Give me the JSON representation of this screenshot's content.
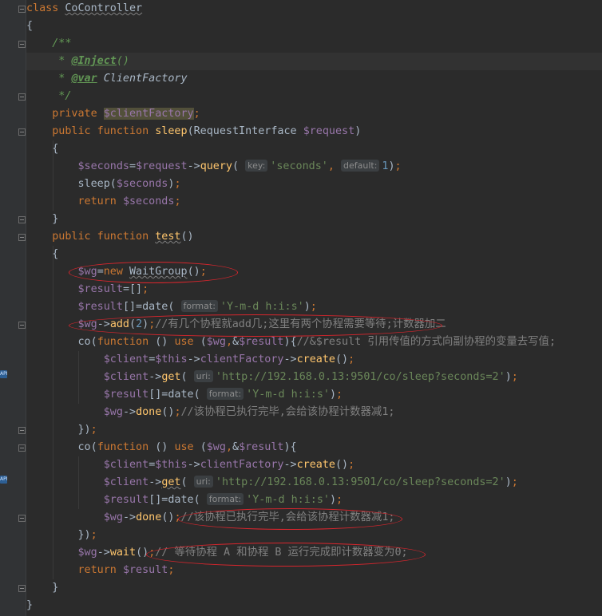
{
  "editor": {
    "lines": [
      {
        "t": [
          {
            "c": "kw",
            "v": "class"
          },
          {
            "v": " "
          },
          {
            "c": "wavy",
            "v": "CoController"
          }
        ]
      },
      {
        "t": [
          {
            "v": "{"
          }
        ]
      },
      {
        "t": [
          {
            "c": "doc",
            "v": "    /**"
          }
        ]
      },
      {
        "hl": true,
        "t": [
          {
            "c": "doc",
            "v": "     * "
          },
          {
            "c": "doctag",
            "v": "@Inject"
          },
          {
            "c": "doc",
            "v": "()"
          }
        ]
      },
      {
        "t": [
          {
            "c": "doc",
            "v": "     * "
          },
          {
            "c": "doctag",
            "v": "@var"
          },
          {
            "c": "docref",
            "v": " ClientFactory"
          }
        ]
      },
      {
        "t": [
          {
            "c": "doc",
            "v": "     */"
          }
        ]
      },
      {
        "t": [
          {
            "c": "kw",
            "v": "    private "
          },
          {
            "c": "var fieldhl",
            "v": "$clientFactory"
          },
          {
            "c": "kw",
            "v": ";"
          }
        ]
      },
      {
        "t": [
          {
            "c": "kw",
            "v": "    public function "
          },
          {
            "c": "fn",
            "v": "sleep"
          },
          {
            "v": "(RequestInterface "
          },
          {
            "c": "var",
            "v": "$request"
          },
          {
            "v": ")"
          }
        ]
      },
      {
        "t": [
          {
            "v": "    {"
          }
        ]
      },
      {
        "t": [
          {
            "c": "var",
            "v": "        $seconds"
          },
          {
            "v": "="
          },
          {
            "c": "var",
            "v": "$request"
          },
          {
            "v": "->"
          },
          {
            "c": "fn",
            "v": "query"
          },
          {
            "v": "( "
          },
          {
            "h": "key:"
          },
          {
            "c": "str",
            "v": "'seconds'"
          },
          {
            "c": "kw",
            "v": ", "
          },
          {
            "h": "default:"
          },
          {
            "c": "num",
            "v": "1"
          },
          {
            "v": ")"
          },
          {
            "c": "kw",
            "v": ";"
          }
        ]
      },
      {
        "t": [
          {
            "v": "        sleep("
          },
          {
            "c": "var",
            "v": "$seconds"
          },
          {
            "v": ")"
          },
          {
            "c": "kw",
            "v": ";"
          }
        ]
      },
      {
        "t": [
          {
            "c": "kw",
            "v": "        return "
          },
          {
            "c": "var",
            "v": "$seconds"
          },
          {
            "c": "kw",
            "v": ";"
          }
        ]
      },
      {
        "t": [
          {
            "v": "    }"
          }
        ]
      },
      {
        "t": [
          {
            "c": "kw",
            "v": "    public function "
          },
          {
            "c": "fn wavy",
            "v": "test"
          },
          {
            "v": "()"
          }
        ]
      },
      {
        "t": [
          {
            "v": "    {"
          }
        ]
      },
      {
        "t": [
          {
            "c": "var",
            "v": "        $wg"
          },
          {
            "v": "="
          },
          {
            "c": "kw",
            "v": "new "
          },
          {
            "c": "wavy",
            "v": "WaitGroup"
          },
          {
            "v": "()"
          },
          {
            "c": "kw",
            "v": ";"
          }
        ]
      },
      {
        "t": [
          {
            "c": "var",
            "v": "        $result"
          },
          {
            "v": "=[]"
          },
          {
            "c": "kw",
            "v": ";"
          }
        ]
      },
      {
        "t": [
          {
            "c": "var",
            "v": "        $result"
          },
          {
            "v": "[]=date( "
          },
          {
            "h": "format:"
          },
          {
            "c": "str",
            "v": "'Y-m-d h:i:s'"
          },
          {
            "v": ")"
          },
          {
            "c": "kw",
            "v": ";"
          }
        ]
      },
      {
        "t": [
          {
            "c": "var",
            "v": "        $wg"
          },
          {
            "v": "->"
          },
          {
            "c": "fn",
            "v": "add"
          },
          {
            "v": "("
          },
          {
            "c": "num",
            "v": "2"
          },
          {
            "v": ")"
          },
          {
            "c": "kw",
            "v": ";"
          },
          {
            "c": "cmt",
            "v": "//有几个协程就add几;这里有两个协程需要等待;计数器加二"
          }
        ]
      },
      {
        "t": [
          {
            "v": "        co("
          },
          {
            "c": "kw",
            "v": "function "
          },
          {
            "v": "() "
          },
          {
            "c": "kw",
            "v": "use "
          },
          {
            "v": "("
          },
          {
            "c": "var",
            "v": "$wg"
          },
          {
            "c": "kw",
            "v": ","
          },
          {
            "v": "&"
          },
          {
            "c": "var",
            "v": "$result"
          },
          {
            "v": "){"
          },
          {
            "c": "cmt",
            "v": "//&$result 引用传值的方式向副协程的变量去写值;"
          }
        ]
      },
      {
        "t": [
          {
            "c": "var",
            "v": "            $client"
          },
          {
            "v": "="
          },
          {
            "c": "var",
            "v": "$this"
          },
          {
            "v": "->"
          },
          {
            "c": "var",
            "v": "clientFactory"
          },
          {
            "v": "->"
          },
          {
            "c": "fn",
            "v": "create"
          },
          {
            "v": "()"
          },
          {
            "c": "kw",
            "v": ";"
          }
        ]
      },
      {
        "t": [
          {
            "c": "var",
            "v": "            $client"
          },
          {
            "v": "->"
          },
          {
            "c": "fn",
            "v": "get"
          },
          {
            "v": "( "
          },
          {
            "h": "uri:"
          },
          {
            "c": "str",
            "v": "'http://192.168.0.13:9501/co/sleep?seconds=2'"
          },
          {
            "v": ")"
          },
          {
            "c": "kw",
            "v": ";"
          }
        ]
      },
      {
        "t": [
          {
            "c": "var",
            "v": "            $result"
          },
          {
            "v": "[]=date( "
          },
          {
            "h": "format:"
          },
          {
            "c": "str",
            "v": "'Y-m-d h:i:s'"
          },
          {
            "v": ")"
          },
          {
            "c": "kw",
            "v": ";"
          }
        ]
      },
      {
        "t": [
          {
            "c": "var",
            "v": "            $wg"
          },
          {
            "v": "->"
          },
          {
            "c": "fn",
            "v": "done"
          },
          {
            "v": "()"
          },
          {
            "c": "kw",
            "v": ";"
          },
          {
            "c": "cmt",
            "v": "//该协程已执行完毕,会给该协程计数器减1;"
          }
        ]
      },
      {
        "t": [
          {
            "v": "        })"
          },
          {
            "c": "kw",
            "v": ";"
          }
        ]
      },
      {
        "t": [
          {
            "v": "        co("
          },
          {
            "c": "kw",
            "v": "function "
          },
          {
            "v": "() "
          },
          {
            "c": "kw",
            "v": "use "
          },
          {
            "v": "("
          },
          {
            "c": "var",
            "v": "$wg"
          },
          {
            "c": "kw",
            "v": ","
          },
          {
            "v": "&"
          },
          {
            "c": "var",
            "v": "$result"
          },
          {
            "v": "){"
          }
        ]
      },
      {
        "t": [
          {
            "c": "var",
            "v": "            $client"
          },
          {
            "v": "="
          },
          {
            "c": "var",
            "v": "$this"
          },
          {
            "v": "->"
          },
          {
            "c": "var",
            "v": "clientFactory"
          },
          {
            "v": "->"
          },
          {
            "c": "fn",
            "v": "create"
          },
          {
            "v": "()"
          },
          {
            "c": "kw",
            "v": ";"
          }
        ]
      },
      {
        "t": [
          {
            "c": "var",
            "v": "            $client"
          },
          {
            "v": "->"
          },
          {
            "c": "fn wavy",
            "v": "get"
          },
          {
            "v": "( "
          },
          {
            "h": "uri:"
          },
          {
            "c": "str",
            "v": "'http://192.168.0.13:9501/co/sleep?seconds=2'"
          },
          {
            "v": ")"
          },
          {
            "c": "kw",
            "v": ";"
          }
        ]
      },
      {
        "t": [
          {
            "c": "var",
            "v": "            $result"
          },
          {
            "v": "[]=date( "
          },
          {
            "h": "format:"
          },
          {
            "c": "str",
            "v": "'Y-m-d h:i:s'"
          },
          {
            "v": ")"
          },
          {
            "c": "kw",
            "v": ";"
          }
        ]
      },
      {
        "t": [
          {
            "c": "var",
            "v": "            $wg"
          },
          {
            "v": "->"
          },
          {
            "c": "fn",
            "v": "done"
          },
          {
            "v": "()"
          },
          {
            "c": "kw",
            "v": ";"
          },
          {
            "c": "cmt",
            "v": "//该协程已执行完毕,会给该协程计数器减1;"
          }
        ]
      },
      {
        "t": [
          {
            "v": "        })"
          },
          {
            "c": "kw",
            "v": ";"
          }
        ]
      },
      {
        "t": [
          {
            "c": "var",
            "v": "        $wg"
          },
          {
            "v": "->"
          },
          {
            "c": "fn",
            "v": "wait"
          },
          {
            "v": "()"
          },
          {
            "c": "kw",
            "v": ";"
          },
          {
            "c": "cmt",
            "v": "// 等待协程 A 和协程 B 运行完成即计数器变为0;"
          }
        ]
      },
      {
        "t": [
          {
            "c": "kw",
            "v": "        return "
          },
          {
            "c": "var",
            "v": "$result"
          },
          {
            "c": "kw",
            "v": ";"
          }
        ]
      },
      {
        "t": [
          {
            "v": "    }"
          }
        ]
      },
      {
        "t": [
          {
            "v": "}"
          }
        ]
      }
    ]
  },
  "gutter": {
    "api_badge_label": "API"
  }
}
